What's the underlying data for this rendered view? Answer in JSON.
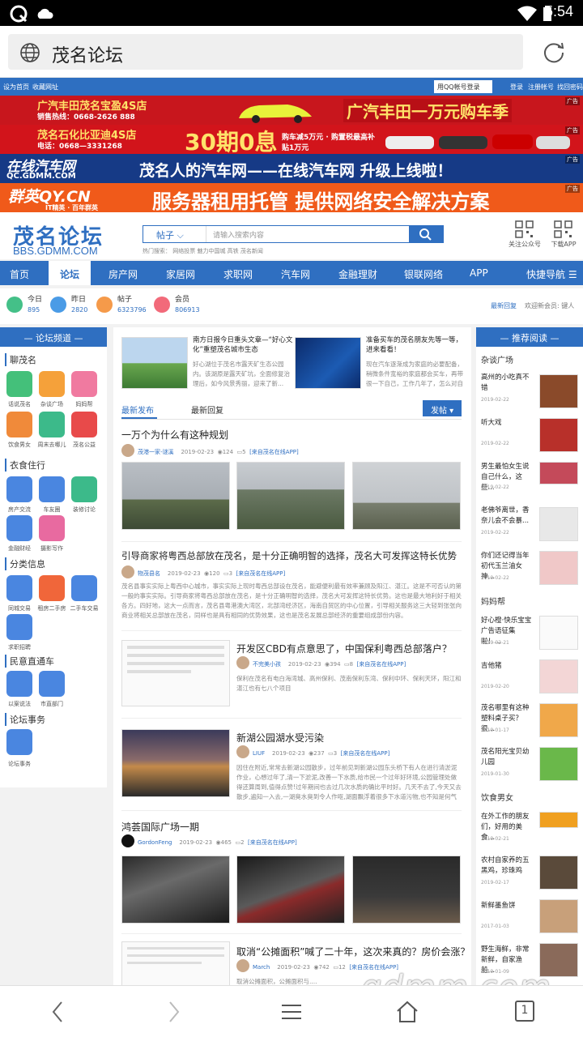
{
  "status": {
    "time": "5:54"
  },
  "browser": {
    "url": "茂名论坛"
  },
  "topbar": {
    "set_home": "设为首页",
    "bookmark": "收藏网址",
    "qq_login": "用QQ帐号登录",
    "login": "登录",
    "register": "注册帐号",
    "find_pwd": "找回密码"
  },
  "banners": [
    {
      "left": "广汽丰田茂名宝盈4S店",
      "left2": "销售热线：0668-2626 888",
      "right": "广汽丰田一万元购车季",
      "color": "#c8161d"
    },
    {
      "left": "茂名石化比亚迪4S店",
      "left2": "电话：0668—3331268",
      "right": "30期0息",
      "extra": "购车减5万元 · 购置税最高补贴1万元",
      "color": "#d2141b"
    },
    {
      "left": "在线汽车网",
      "left2": "QC.GDMM.COM",
      "right": "茂名人的汽车网——在线汽车网 升级上线啦！",
      "color": "#163a86"
    },
    {
      "left": "群英QY.CN",
      "left2": "IT精英 · 百年群英",
      "right": "服务器租用托管   提供网络安全解决方案",
      "color": "#f05a1a"
    }
  ],
  "ad_label": "广告",
  "header": {
    "logo": "茂名论坛",
    "logo_url": "BBS.GDMM.COM",
    "search_type": "帖子",
    "search_placeholder": "请输入搜索内容",
    "hot_label": "热门搜索：",
    "hot_words": "网络投票  魅力中国城  高铁  茂名新闻",
    "follow": "关注公众号",
    "download": "下载APP"
  },
  "nav": {
    "items": [
      "首页",
      "论坛",
      "房产网",
      "家居网",
      "求职网",
      "汽车网",
      "金融理财",
      "银联网络",
      "APP"
    ],
    "quick": "快捷导航"
  },
  "stats": [
    {
      "label": "今日",
      "num": "895",
      "color": "#44c088"
    },
    {
      "label": "昨日",
      "num": "2820",
      "color": "#4a9be6"
    },
    {
      "label": "帖子",
      "num": "6323796",
      "color": "#f59a4a"
    },
    {
      "label": "会员",
      "num": "806913",
      "color": "#f26a7a"
    }
  ],
  "stats_right": {
    "recent": "最新回复",
    "welcome": "欢迎新会员: 键人"
  },
  "left_panel": {
    "title": "论坛频道",
    "sections": [
      {
        "name": "聊茂名",
        "items": [
          "话说茂名",
          "杂谈广场",
          "妈妈帮",
          "饮食男女",
          "周末去哪儿",
          "茂名公益"
        ]
      },
      {
        "name": "衣食住行",
        "items": [
          "房产交流",
          "车友圈",
          "装修讨论",
          "金融财经",
          "摄影写作"
        ]
      },
      {
        "name": "分类信息",
        "items": [
          "同城交易",
          "租房二手房",
          "二手车交易",
          "求职招聘"
        ]
      },
      {
        "name": "民意直通车",
        "items": [
          "以案说法",
          "市直部门"
        ]
      },
      {
        "name": "论坛事务",
        "items": [
          "论坛事务"
        ]
      }
    ]
  },
  "center": {
    "top_news": [
      {
        "title": "南方日报今日重头文章—“好心文化”重塑茂名城市生态",
        "snippet": "好心湖位于茂名市露天矿生态公园内。该湖原是露天矿坑，全面修复治理后，如今风景秀丽，迎来了新..."
      },
      {
        "title": "准备买车的茂名朋友先等一等，进来看看！",
        "snippet": "现在汽车逐渐成为家庭的必要配备，稍微条件宽裕的家庭都会买车，再带很一下自己，工作几年了，怎么对自己那么..."
      }
    ],
    "tabs": [
      "最新发布",
      "最新回复"
    ],
    "post_button": "发帖",
    "posts": [
      {
        "title": "一万个为什么有这种规划",
        "user": "茂港一家-谜溪",
        "date": "2019-02-23",
        "views": "124",
        "replies": "5",
        "source": "[来自茂名在线APP]"
      },
      {
        "title": "引导商家将粤西总部放在茂名，是十分正确明智的选择，茂名大可发挥这特长优势",
        "user": "物茂县名",
        "date": "2019-02-23",
        "views": "120",
        "replies": "3",
        "source": "[来自茂名在线APP]",
        "snippet": "茂名县事实实际上粤西中心城市，事实实际上现时粤西总部设在茂名，能避便利最有效率兼顾及阳江、湛江。这是不可否认的第一般的事实实际。引导商家将粤西总部放在茂名，是十分正确明智的选择，茂名大可发挥这特长优势。这也是最大地利好于相关各方。四好地，这大一点而言，茂名县粤港澳大湾区，北部湾经济区，海南自贸区的中心位置，引导相关服务这三大轻到张张向商业将相关总部放在茂名，同样也是具有相同的优势效果，这也是茂名发展总部经济的重要组成部份内容。"
      },
      {
        "title": "开发区CBD有点意思了，中国保利粤西总部落户？",
        "user": "不完美小孩",
        "date": "2019-02-23",
        "views": "394",
        "replies": "8",
        "source": "[来自茂名在线APP]",
        "snippet": "保利在茂名有电白海湾城、高州保利、茂南保利东湾、保利中环、保利天环，阳江和湛江也有七八个项目"
      },
      {
        "title": "新湖公园湖水受污染",
        "user": "LIUF",
        "date": "2019-02-23",
        "views": "237",
        "replies": "3",
        "source": "[来自茂名在线APP]",
        "snippet": "因住在附近,常常去新湖公园散步，过年前见到新湖公园东头桥下有人在进行清淤泥作业，心想过年了,清一下淤泥,改善一下水质,给市民一个过年好环境,公园管理处做得还算周到,值得点赞!过年期间也去过几次水质的确比平时好。几天不去了,今天又去散步,遍知一入去,一湖臭水臭到令人作呕,湖面飘浮着很多下水道污物,也不知是何气带出来..."
      },
      {
        "title": "鸿荟国际广场一期",
        "user": "GordonFeng",
        "date": "2019-02-23",
        "views": "465",
        "replies": "2",
        "source": "[来自茂名在线APP]"
      },
      {
        "title": "取消“公摊面积”喊了二十年，这次来真的？房价会涨？",
        "user": "March",
        "date": "2019-02-23",
        "views": "742",
        "replies": "12",
        "source": "[来自茂名在线APP]",
        "snippet": "取消公摊面积，公摊面积与...."
      }
    ]
  },
  "right_panel": {
    "title": "推荐阅读",
    "groups": [
      {
        "cat": "杂谈广场",
        "items": [
          {
            "title": "高州的小吃真不错",
            "date": "2019-02-22"
          },
          {
            "title": "听大戏",
            "date": "2019-02-22"
          },
          {
            "title": "男生最怕女生说自己什么，这些...",
            "date": "2019-02-22"
          },
          {
            "title": "老佛爷离世，香奈儿会不会暴...",
            "date": "2019-02-22"
          },
          {
            "title": "你们还记得当年初代玉兰油女神...",
            "date": "2019-02-22"
          }
        ]
      },
      {
        "cat": "妈妈帮",
        "items": [
          {
            "title": "好心橙·快乐宝宝广告语征集啦！...",
            "date": "2019-02-21"
          },
          {
            "title": "吉他猪",
            "date": "2019-02-20"
          },
          {
            "title": "茂名哪里有这种塑料桌子买？很...",
            "date": "2019-01-17"
          },
          {
            "title": "茂名阳光宝贝幼儿园",
            "date": "2019-01-30"
          }
        ]
      },
      {
        "cat": "饮食男女",
        "items": [
          {
            "title": "在外工作的朋友们，好用的美食...",
            "date": "2019-02-21"
          },
          {
            "title": "农村自家养的五黑鸡，珍珠鸡",
            "date": "2019-02-17"
          },
          {
            "title": "新鲜墨鱼饼",
            "date": "2017-01-03"
          },
          {
            "title": "野生海鲜，非常新鲜，自家渔船...",
            "date": "2019-01-09"
          }
        ]
      }
    ]
  },
  "watermark": "gdmm.com",
  "photo_watermark": "gdmm.com",
  "tab_count": "1"
}
